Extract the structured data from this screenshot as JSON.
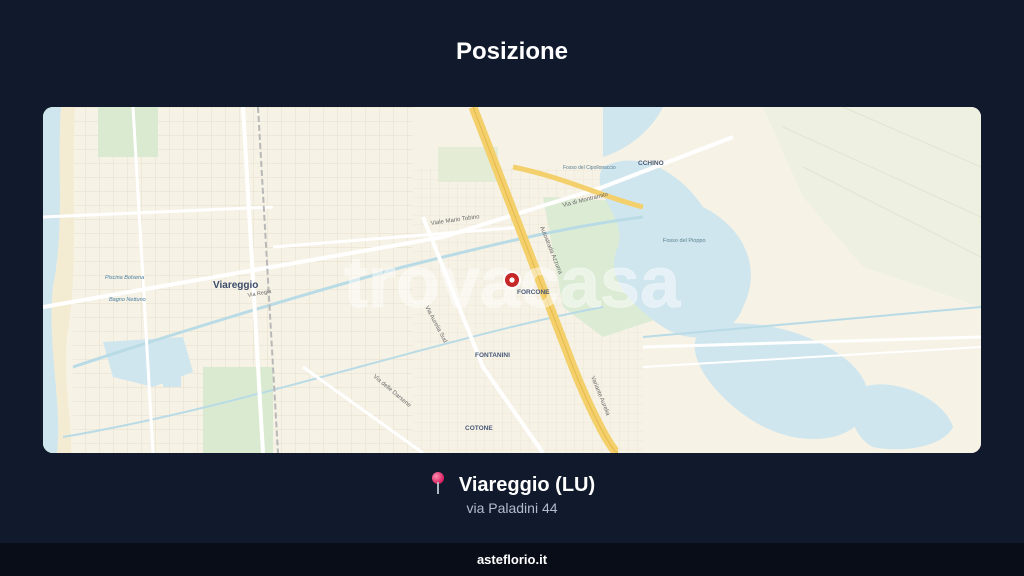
{
  "header": {
    "title": "Posizione"
  },
  "map": {
    "watermark": "trovacasa",
    "labels": {
      "city": "Viareggio",
      "forcone": "FORCONE",
      "fontanini": "FONTANINI",
      "cotone": "COTONE",
      "cchino": "CCHINO",
      "viale_mario_tobino": "Viale Mario Tobino",
      "via_di_montramito": "Via di Montramito",
      "via_aurelia_sud": "Via Aurelia Sud",
      "autostrada_azzurra": "Autostrada Azzurra",
      "variante_aurelia": "Variante Aurelia",
      "via_delle_darsene": "Via delle Darsene",
      "piscina_bolsena": "Piscina Bolsena",
      "bagno_nettuno": "Bagno Nettuno",
      "fosso_del_pioppo": "Fosso del Pioppo",
      "fosso_del_cipollonaccio": "Fosso del Cipollonaccio",
      "via_regia": "Via Regia"
    },
    "marker_icon": "location-pin-icon",
    "colors": {
      "land": "#f6f2e6",
      "water": "#cfe6ee",
      "park": "#d9ead1",
      "highway": "#f3d06b",
      "marker": "#c62828"
    }
  },
  "location": {
    "icon": "pushpin-icon",
    "city": "Viareggio (LU)",
    "address": "via Paladini 44"
  },
  "footer": {
    "site": "asteflorio.it"
  }
}
